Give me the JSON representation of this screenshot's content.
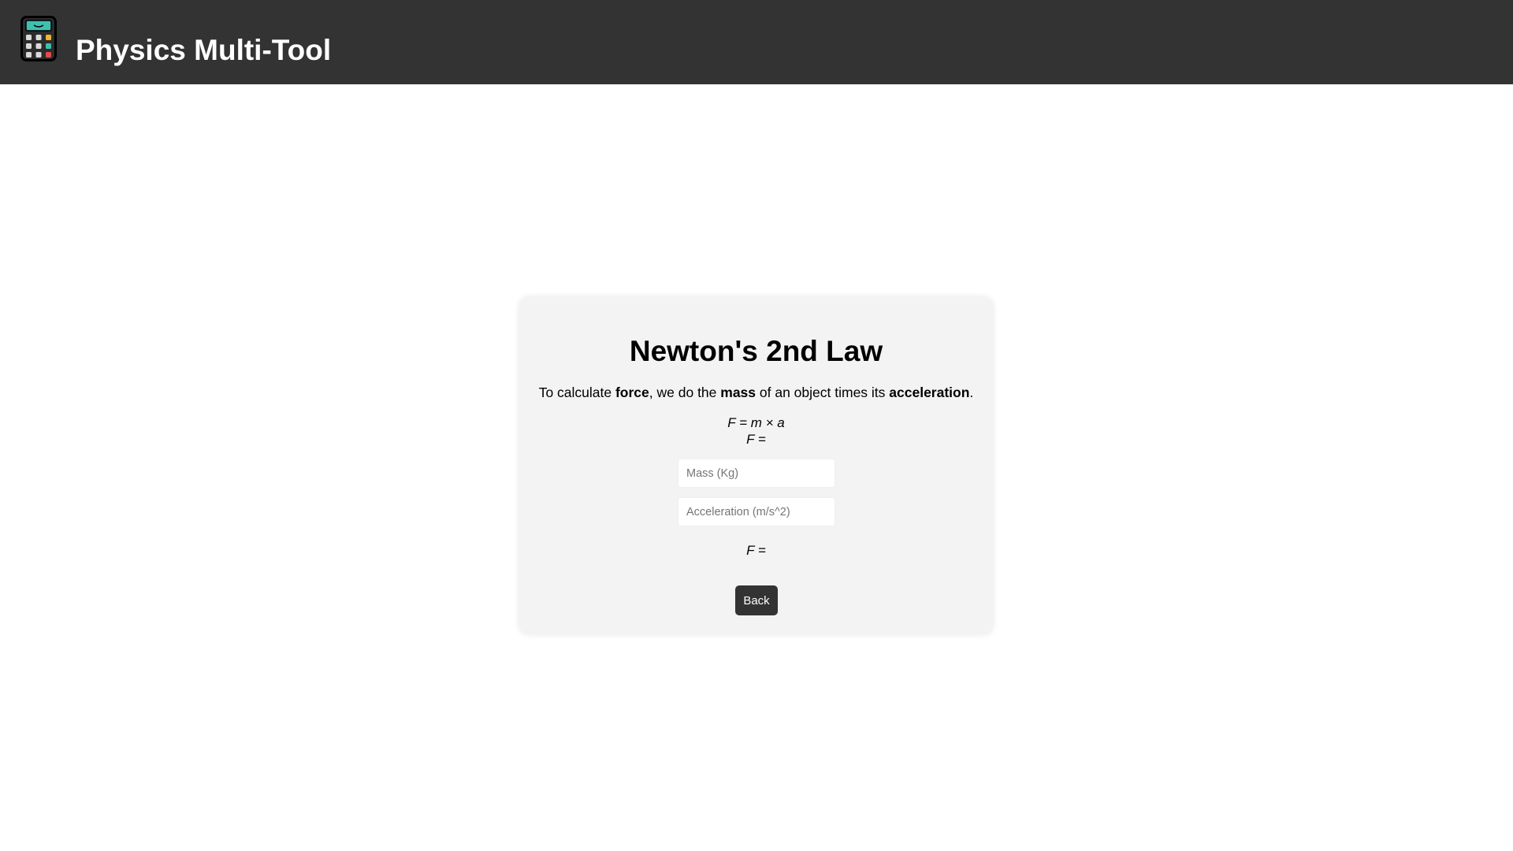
{
  "header": {
    "title": "Physics Multi-Tool",
    "logo_icon": "calculator-icon"
  },
  "card": {
    "title": "Newton's 2nd Law",
    "description": {
      "p1": "To calculate ",
      "b1": "force",
      "p2": ", we do the ",
      "b2": "mass",
      "p3": " of an object times its ",
      "b3": "acceleration",
      "p4": "."
    },
    "formula": "F = m × a",
    "formula_result": "F =",
    "mass_input": {
      "placeholder": "Mass (Kg)",
      "value": ""
    },
    "acceleration_input": {
      "placeholder": "Acceleration (m/s^2)",
      "value": ""
    },
    "result": "F =",
    "back_label": "Back"
  },
  "colors": {
    "header_bg": "#333333",
    "card_bg": "#f3f3f3",
    "button_bg": "#333333",
    "logo_screen": "#3fbfb0"
  }
}
